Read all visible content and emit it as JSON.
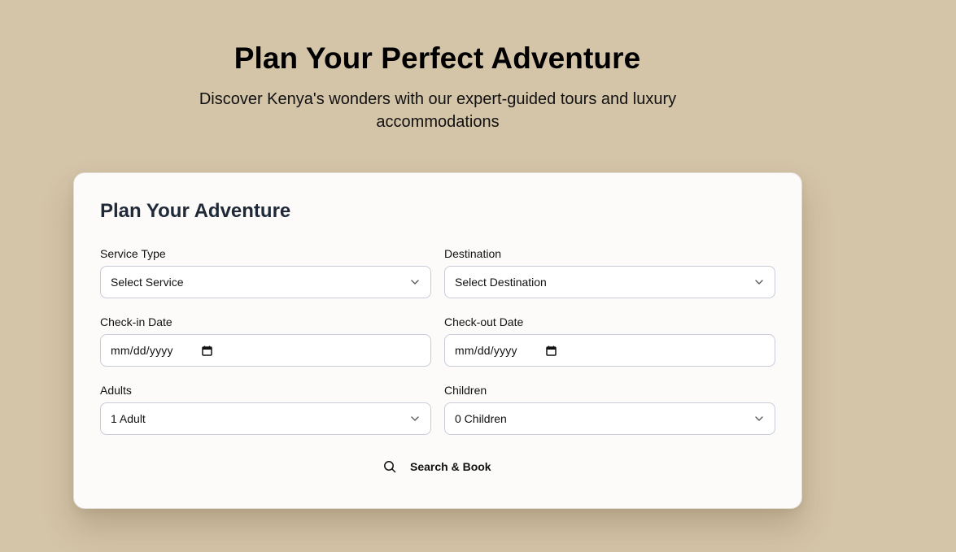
{
  "hero": {
    "title": "Plan Your Perfect Adventure",
    "subtitle": "Discover Kenya's wonders with our expert-guided tours and luxury accommodations"
  },
  "form": {
    "title": "Plan Your Adventure",
    "service_type": {
      "label": "Service Type",
      "value": "Select Service"
    },
    "destination": {
      "label": "Destination",
      "value": "Select Destination"
    },
    "check_in": {
      "label": "Check-in Date",
      "value": "mm/dd/yyyy"
    },
    "check_out": {
      "label": "Check-out Date",
      "value": "mm/dd/yyyy"
    },
    "adults": {
      "label": "Adults",
      "value": "1 Adult"
    },
    "children": {
      "label": "Children",
      "value": "0 Children"
    },
    "submit_label": "Search & Book"
  },
  "icons": {
    "select": "chevron-down-icon",
    "date": "calendar-icon",
    "submit": "search-icon"
  },
  "colors": {
    "background": "#d4c4a8",
    "card": "#fcfbf9",
    "heading": "#1f2937",
    "input_border": "#c8ccd8"
  }
}
